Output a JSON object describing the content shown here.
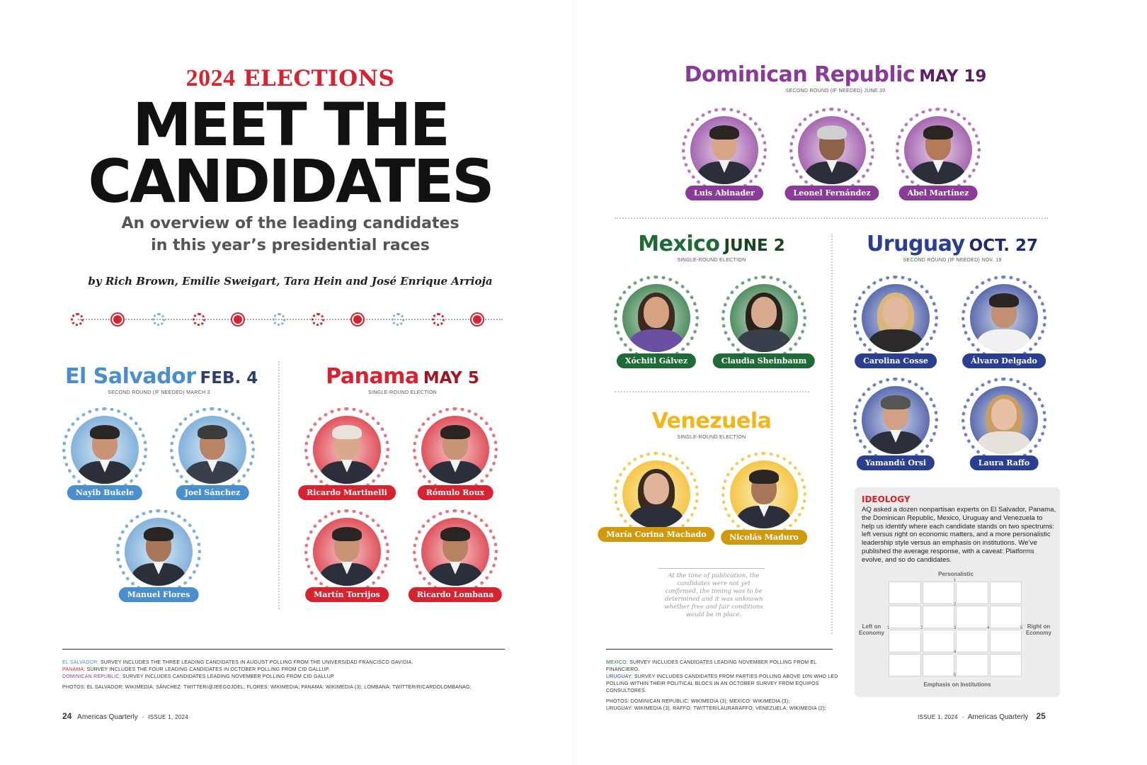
{
  "left": {
    "kicker_year": "2024",
    "kicker_word": "ELECTIONS",
    "headline_line1": "MEET THE",
    "headline_line2": "CANDIDATES",
    "dek_line1": "An overview of the leading candidates",
    "dek_line2": "in this year’s presidential races",
    "byline": "by Rich Brown, Emilie Sweigart, Tara Hein and José Enrique Arrioja"
  },
  "colors": {
    "red": "#d6232f",
    "el_salvador": "#4a8fcd",
    "panama": "#d6232f",
    "dominican": "#8a3b97",
    "mexico": "#1f6b35",
    "uruguay": "#2a3f92",
    "venezuela": "#f2b618"
  },
  "countries": {
    "el_salvador": {
      "name": "El Salvador",
      "date": "FEB. 4",
      "sub": "SECOND ROUND (IF NEEDED) MARCH 3",
      "candidates": [
        "Nayib Bukele",
        "Joel Sánchez",
        "Manuel Flores"
      ]
    },
    "panama": {
      "name": "Panama",
      "date": "MAY 5",
      "sub": "SINGLE-ROUND ELECTION",
      "candidates": [
        "Ricardo Martinelli",
        "Rómulo Roux",
        "Martín Torrijos",
        "Ricardo Lombana"
      ]
    },
    "dominican": {
      "name": "Dominican Republic",
      "date": "MAY 19",
      "sub": "SECOND ROUND (IF NEEDED) JUNE 30",
      "candidates": [
        "Luis Abinader",
        "Leonel Fernández",
        "Abel Martínez"
      ]
    },
    "mexico": {
      "name": "Mexico",
      "date": "JUNE 2",
      "sub": "SINGLE-ROUND ELECTION",
      "candidates": [
        "Xóchitl Gálvez",
        "Claudia Sheinbaum"
      ]
    },
    "uruguay": {
      "name": "Uruguay",
      "date": "OCT. 27",
      "sub": "SECOND ROUND (IF NEEDED) NOV. 19",
      "candidates": [
        "Carolina Cosse",
        "Álvaro Delgado",
        "Yamandú Orsi",
        "Laura Raffo"
      ]
    },
    "venezuela": {
      "name": "Venezuela",
      "sub": "SINGLE-ROUND ELECTION",
      "candidates": [
        "María Corina Machado",
        "Nicolás Maduro"
      ],
      "note": "At the time of publication, the candidates were not yet confirmed, the timing was to be determined and it was unknown whether free and fair conditions would be in place."
    }
  },
  "notes_left": {
    "es_label": "EL SALVADOR:",
    "es_text": " SURVEY INCLUDES THE THREE LEADING CANDIDATES IN AUGUST POLLING FROM THE UNIVERSIDAD FRANCISCO GAVIDIA.",
    "pa_label": "PANAMA:",
    "pa_text": " SURVEY INCLUDES THE FOUR LEADING CANDIDATES IN OCTOBER POLLING FROM CID GALLUP.",
    "dr_label": "DOMINICAN REPUBLIC:",
    "dr_text": " SURVEY INCLUDES CANDIDATES LEADING NOVEMBER POLLING FROM CID GALLUP.",
    "photos": "PHOTOS: EL SALVADOR: WIKIMEDIA; SÁNCHEZ: TWITTER/@JEEGOJOEL; FLORES: WIKIMEDIA; PANAMA: WIKIMEDIA (3); LOMBANA: TWITTER/RICARDOLOMBANAG;"
  },
  "notes_right": {
    "mx_label": "MEXICO:",
    "mx_text": " SURVEY INCLUDES CANDIDATES LEADING NOVEMBER POLLING FROM EL FINANCIERO.",
    "uy_label": "URUGUAY:",
    "uy_text": " SURVEY INCLUDES CANDIDATES FROM PARTIES POLLING ABOVE 10% WHO LED POLLING WITHIN THEIR POLITICAL BLOCS IN AN OCTOBER SURVEY FROM EQUIPOS CONSULTORES.",
    "photos1": "PHOTOS: DOMINICAN REPUBLIC: WIKIMEDIA (3); MEXICO: WIKIMEDIA (3);",
    "photos2": "URUGUAY: WIKIMEDIA (3), RAFFO: TWITTER/LAURARAFFO; VENEZUELA: WIKIMEDIA (2);"
  },
  "folio_left": {
    "page": "24",
    "pub": "Americas Quarterly",
    "issue": "ISSUE 1, 2024"
  },
  "folio_right": {
    "page": "25",
    "pub": "Americas Quarterly",
    "issue": "ISSUE 1, 2024"
  },
  "ideology": {
    "title": "IDEOLOGY",
    "text": "AQ asked a dozen nonpartisan experts on El Salvador, Panama, the Dominican Republic, Mexico, Uruguay and Venezuela to help us identify where each candidate stands on two spectrums: left versus right on economic matters, and a more personalistic leadership style versus an emphasis on institutions. We’ve published the average response, with a caveat: Platforms evolve, and so do candidates.",
    "top_label": "Personalistic",
    "bottom_label": "Emphasis on Institutions",
    "left_label": "Left on Economy",
    "right_label": "Right on Economy",
    "ticks": [
      "1",
      "2",
      "3",
      "4",
      "5"
    ]
  }
}
